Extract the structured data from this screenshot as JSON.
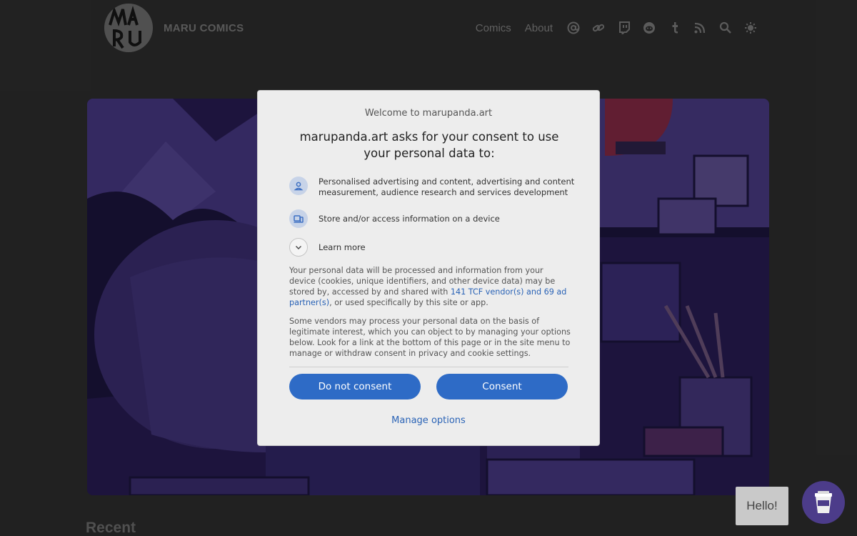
{
  "site": {
    "title": "MARU COMICS",
    "nav": {
      "comics": "Comics",
      "about": "About"
    },
    "icons": [
      "at-icon",
      "link-icon",
      "twitch-icon",
      "reddit-icon",
      "tumblr-icon",
      "rss-icon",
      "search-icon",
      "theme-toggle-icon"
    ]
  },
  "recent_heading": "Recent",
  "hello": "Hello!",
  "consent": {
    "welcome": "Welcome to marupanda.art",
    "headline": "marupanda.art asks for your consent to use your personal data to:",
    "purposes": [
      "Personalised advertising and content, advertising and content measurement, audience research and services development",
      "Store and/or access information on a device"
    ],
    "learn_more": "Learn more",
    "para1_before": "Your personal data will be processed and information from your device (cookies, unique identifiers, and other device data) may be stored by, accessed by and shared with ",
    "para1_link": "141 TCF vendor(s) and 69 ad partner(s)",
    "para1_after": ", or used specifically by this site or app.",
    "para2": "Some vendors may process your personal data on the basis of legitimate interest, which you can object to by managing your options below. Look for a link at the bottom of this page or in the site menu to manage or withdraw consent in privacy and cookie settings.",
    "do_not_consent": "Do not consent",
    "consent": "Consent",
    "manage_options": "Manage options"
  },
  "colors": {
    "accent": "#2e6bc6",
    "dialog_bg": "#ededed",
    "page_bg": "#3a3a3a"
  }
}
